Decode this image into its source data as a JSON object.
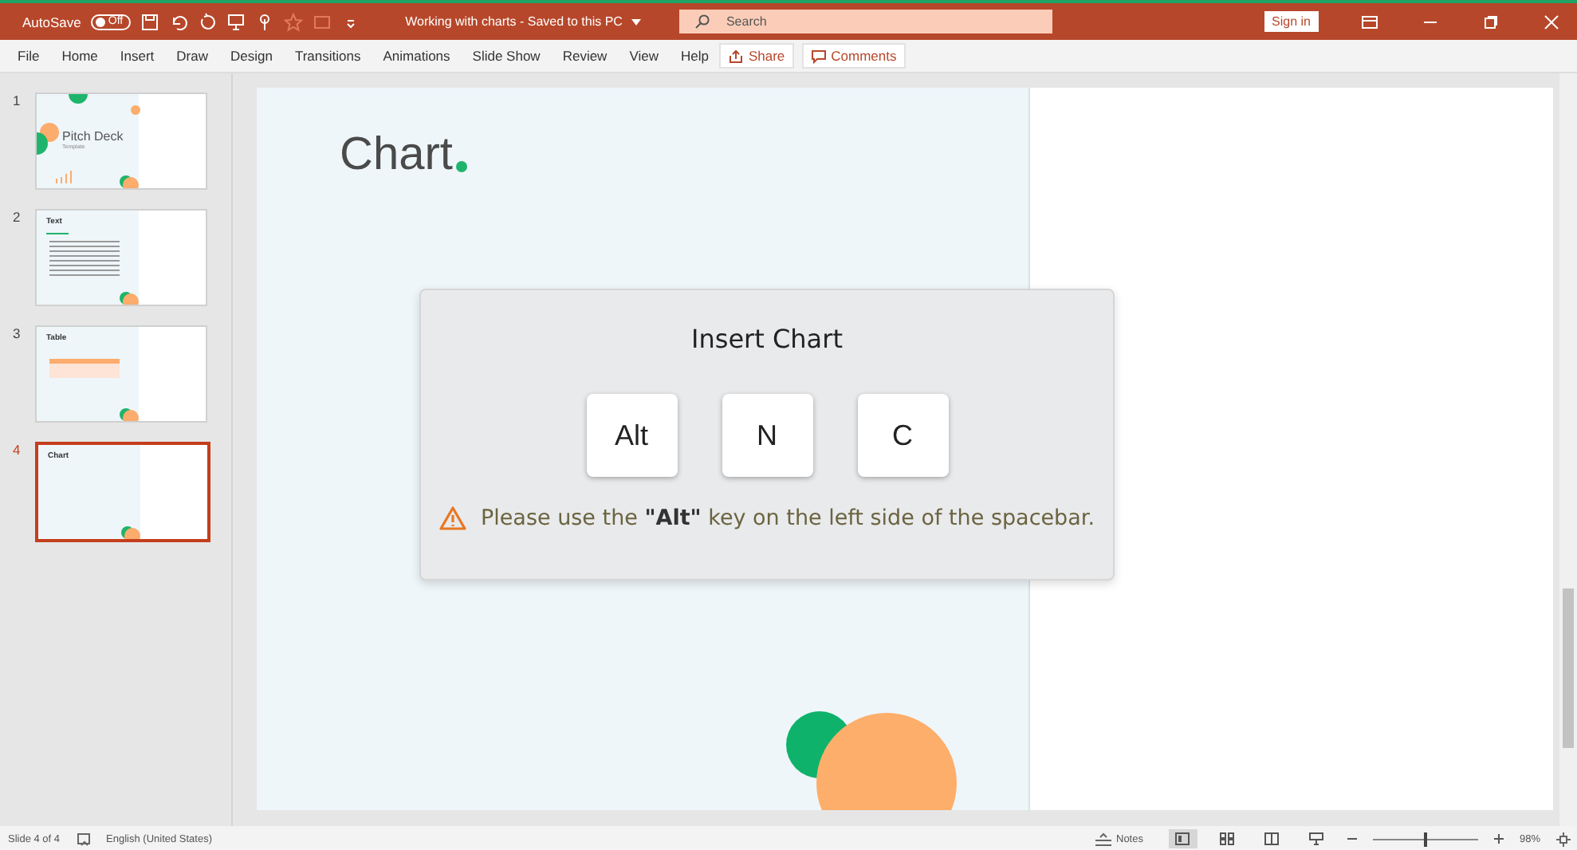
{
  "title_bar": {
    "autosave_label": "AutoSave",
    "autosave_toggle": {
      "label": "Off",
      "on": false
    },
    "document_title": "Working with charts - Saved to this PC",
    "search": {
      "placeholder": "Search"
    },
    "sign_in": "Sign in"
  },
  "ribbon": {
    "tabs": [
      "File",
      "Home",
      "Insert",
      "Draw",
      "Design",
      "Transitions",
      "Animations",
      "Slide Show",
      "Review",
      "View",
      "Help"
    ],
    "share": "Share",
    "comments": "Comments"
  },
  "slides": [
    {
      "number": "1",
      "kind": "title",
      "title": "Pitch Deck",
      "subtitle": "Template",
      "selected": false
    },
    {
      "number": "2",
      "kind": "text",
      "title": "Text",
      "selected": false
    },
    {
      "number": "3",
      "kind": "table",
      "title": "Table",
      "selected": false
    },
    {
      "number": "4",
      "kind": "chart",
      "title": "Chart",
      "selected": true
    }
  ],
  "slide": {
    "title": "Chart"
  },
  "dialog": {
    "title": "Insert Chart",
    "keys": [
      "Alt",
      "N",
      "C"
    ],
    "note": "Please use the **\"Alt\"** key on the left side of the spacebar."
  },
  "status_bar": {
    "slide_info": "Slide 4 of 4",
    "language": "English (United States)",
    "notes": "Notes",
    "zoom": {
      "level": 0.48
    },
    "zoom_text": "98%"
  }
}
